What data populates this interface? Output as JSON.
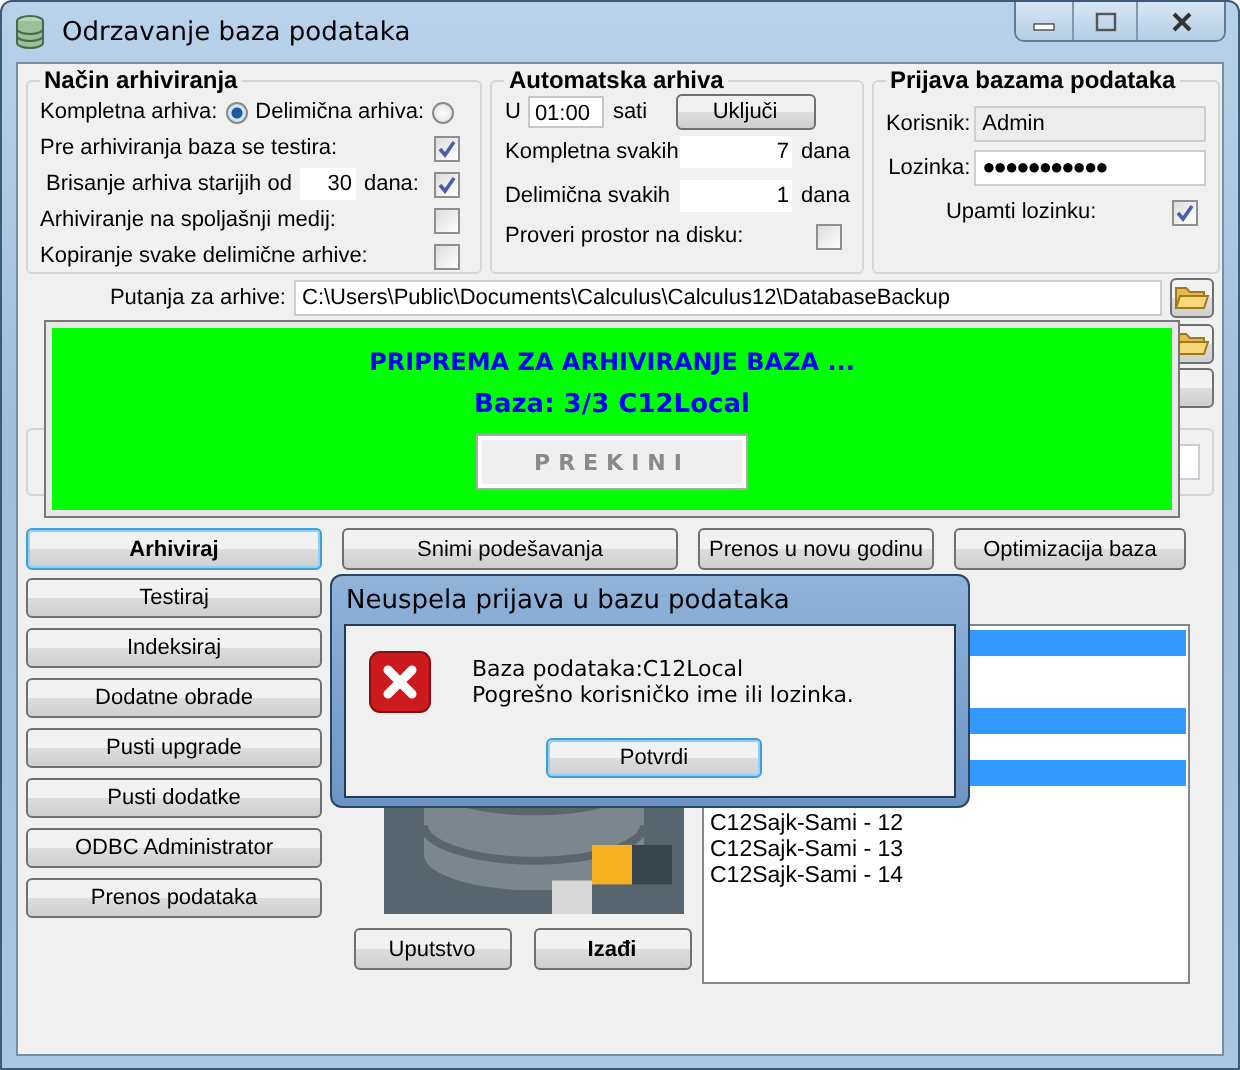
{
  "window": {
    "title": "Odrzavanje baza podataka"
  },
  "archiving_mode": {
    "title": "Način arhiviranja",
    "modes": [
      {
        "label": "Kompletna arhiva:",
        "selected": true
      },
      {
        "label": "Delimična arhiva:",
        "selected": false
      }
    ],
    "options": [
      {
        "kind": "check",
        "label": "Pre arhiviranja baza se testira:",
        "checked": true
      },
      {
        "kind": "days",
        "label": "Brisanje arhiva starijih od",
        "value": "30",
        "unit": "dana:",
        "checked": true
      },
      {
        "kind": "check",
        "label": "Arhiviranje na spoljašnji medij:",
        "checked": false
      },
      {
        "kind": "check",
        "label": "Kopiranje svake delimične arhive:",
        "checked": false
      }
    ]
  },
  "auto_archive": {
    "title": "Automatska arhiva",
    "time_prefix": "U",
    "time": "01:00",
    "time_suffix": "sati",
    "toggle_button": "Uključi",
    "intervals": [
      {
        "label": "Kompletna svakih",
        "value": "7",
        "unit": "dana"
      },
      {
        "label": "Delimična svakih",
        "value": "1",
        "unit": "dana"
      }
    ],
    "disk_check": {
      "label": "Proveri prostor na disku:",
      "checked": false
    }
  },
  "login": {
    "title": "Prijava bazama podataka",
    "user_label": "Korisnik:",
    "user": "Admin",
    "user_disabled": true,
    "password_label": "Lozinka:",
    "password": "●●●●●●●●●●●",
    "remember": {
      "label": "Upamti lozinku:",
      "checked": true
    }
  },
  "path": {
    "label": "Putanja za arhive:",
    "value": "C:\\Users\\Public\\Documents\\Calculus\\Calculus12\\DatabaseBackup"
  },
  "top_buttons": [
    {
      "label": "Arhiviraj",
      "default": true,
      "focused": true
    },
    {
      "label": "Snimi podešavanja",
      "default": false,
      "focused": false
    },
    {
      "label": "Prenos u novu godinu",
      "default": false,
      "focused": false
    },
    {
      "label": "Optimizacija baza",
      "default": false,
      "focused": false
    }
  ],
  "side_buttons": [
    "Testiraj",
    "Indeksiraj",
    "Dodatne obrade",
    "Pusti upgrade",
    "Pusti dodatke",
    "ODBC Administrator",
    "Prenos podataka"
  ],
  "bottom_buttons": [
    {
      "label": "Uputstvo",
      "default": false
    },
    {
      "label": "Izađi",
      "default": true
    }
  ],
  "database_list": [
    {
      "selected": true
    },
    {
      "selected": false
    },
    {
      "selected": false
    },
    {
      "selected": true
    },
    {
      "selected": false
    },
    {
      "selected": true
    },
    {
      "selected": false
    },
    {
      "label": "C12Sajk-Sami - 12",
      "selected": false
    },
    {
      "label": "C12Sajk-Sami - 13",
      "selected": false
    },
    {
      "label": "C12Sajk-Sami - 14",
      "selected": false
    }
  ],
  "progress": {
    "title": "PRIPREMA ZA ARHIVIRANJE BAZA ...",
    "status": "Baza: 3/3   C12Local",
    "cancel_button": "PREKINI"
  },
  "dialog": {
    "title": "Neuspela prijava u bazu podataka",
    "lines": [
      "Baza podataka:C12Local",
      "Pogrešno korisničko ime ili lozinka."
    ],
    "button": "Potvrdi"
  }
}
